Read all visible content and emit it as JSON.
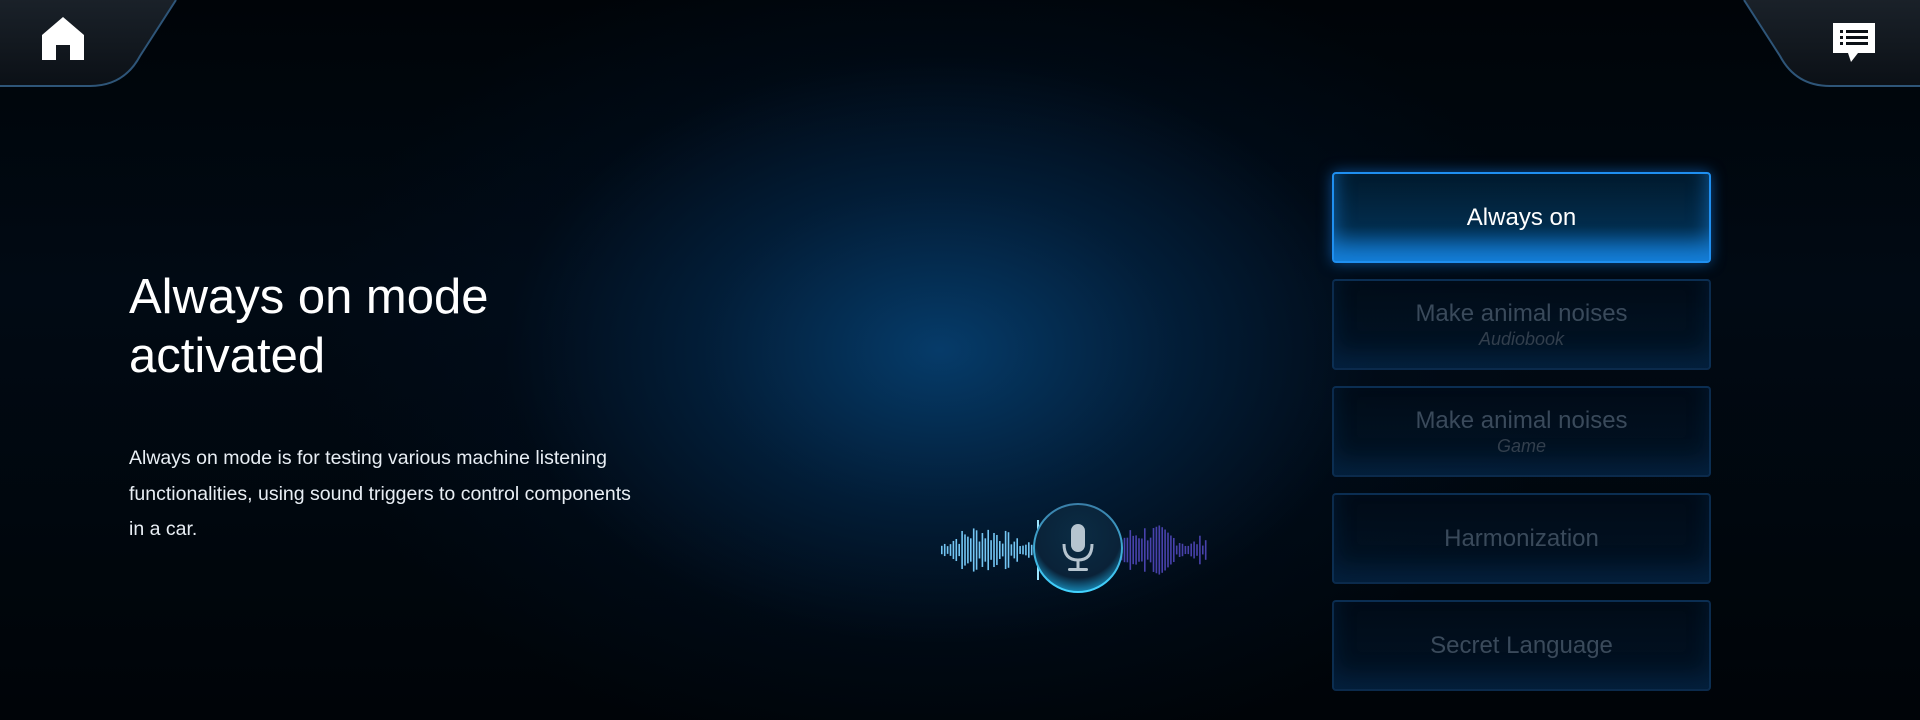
{
  "nav": {
    "home_icon": "home-icon",
    "chat_icon": "chat-icon"
  },
  "main": {
    "title": "Always on mode activated",
    "description": "Always on mode is for testing various machine listening functionalities, using sound triggers to control components in a car."
  },
  "mic": {
    "icon": "microphone-icon"
  },
  "options": [
    {
      "label": "Always on",
      "sublabel": "",
      "active": true
    },
    {
      "label": "Make animal noises",
      "sublabel": "Audiobook",
      "active": false
    },
    {
      "label": "Make animal noises",
      "sublabel": "Game",
      "active": false
    },
    {
      "label": "Harmonization",
      "sublabel": "",
      "active": false
    },
    {
      "label": "Secret Language",
      "sublabel": "",
      "active": false
    }
  ],
  "colors": {
    "accent": "#1f8ff0",
    "wave_left": "#7ad0ff",
    "wave_right": "#5a4fd0",
    "inactive_text": "#3a4a5b"
  }
}
